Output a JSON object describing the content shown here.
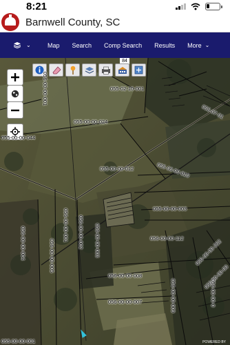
{
  "status": {
    "time": "8:21"
  },
  "header": {
    "county_name": "Barnwell County, SC"
  },
  "nav": {
    "menu_icon": "layers-icon",
    "items": [
      {
        "label": "Map"
      },
      {
        "label": "Search"
      },
      {
        "label": "Comp Search"
      },
      {
        "label": "Results"
      },
      {
        "label": "More"
      }
    ]
  },
  "map": {
    "scale_text": "84",
    "powered_text": "POWERED BY",
    "tools": [
      "info-icon",
      "eraser-icon",
      "pin-icon",
      "layers-stack-icon",
      "print-icon",
      "buildings-icon",
      "extent-icon"
    ],
    "parcels": [
      {
        "id": "055-02-10-001"
      },
      {
        "id": "055-07-01"
      },
      {
        "id": "055-00-00-024"
      },
      {
        "id": "055-00-00-012"
      },
      {
        "id": "055-00-00-010"
      },
      {
        "id": "055-00-00-003"
      },
      {
        "id": "056-00-00-112"
      },
      {
        "id": "056-00-00-252"
      },
      {
        "id": "056-00-00-008"
      },
      {
        "id": "056-00-00-007"
      },
      {
        "id": "056-00-00-009"
      },
      {
        "id": "056-00-00-00"
      },
      {
        "id": "056-00-00-001"
      },
      {
        "id": "056-00-00-002"
      },
      {
        "id": "056-00-00-003"
      },
      {
        "id": "056-00-00-004"
      },
      {
        "id": "055-00-00-044"
      },
      {
        "id": "055-00-00-001"
      },
      {
        "id": "056-00-00-005"
      },
      {
        "id": "056-00-00-0"
      },
      {
        "id": "056-00-00-001"
      }
    ]
  }
}
